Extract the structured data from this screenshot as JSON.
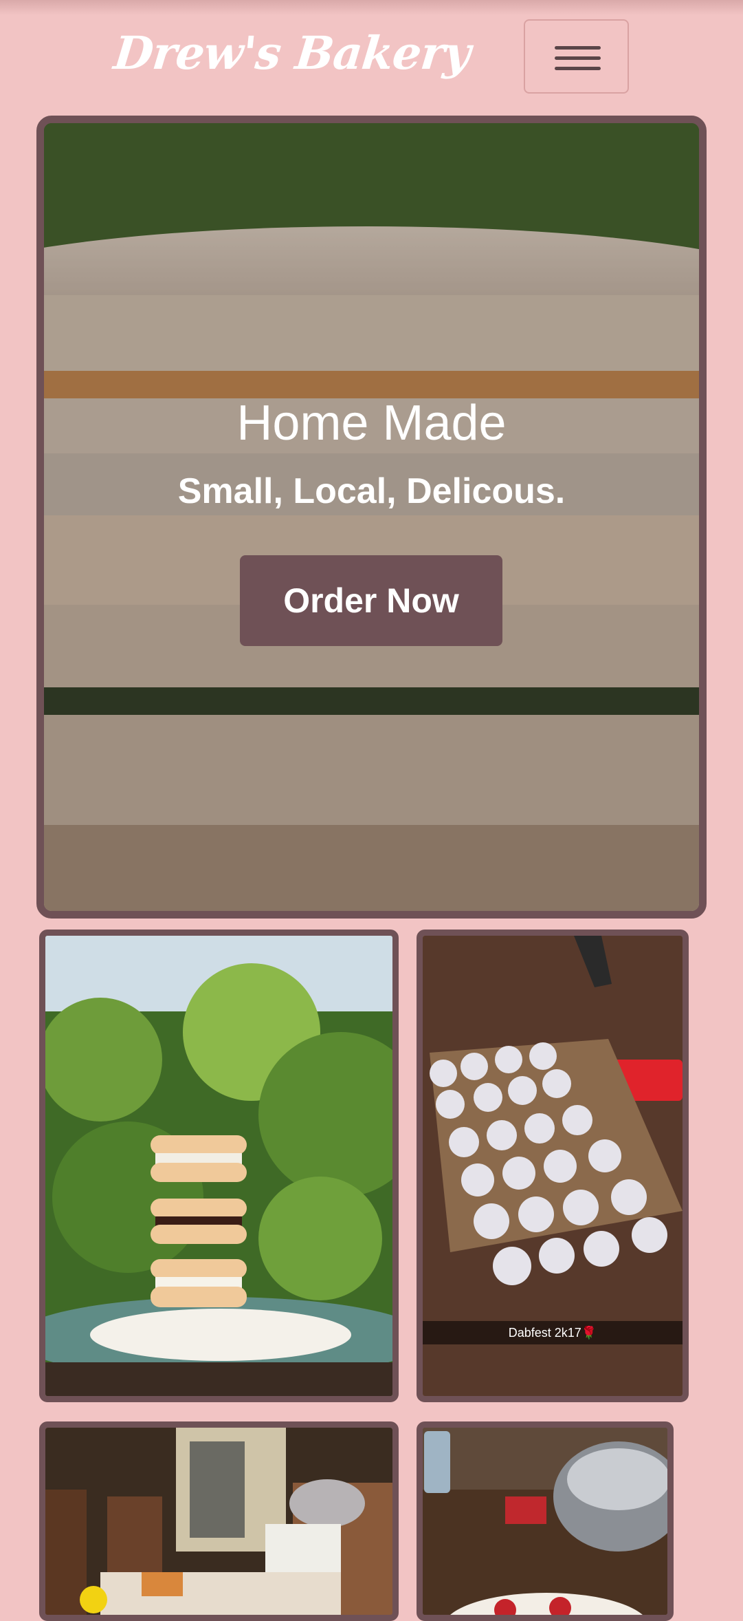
{
  "navbar": {
    "brand": "Drew's Bakery",
    "toggle_icon": "hamburger-menu-icon"
  },
  "hero": {
    "title": "Home Made",
    "subtitle": "Small, Local, Delicous.",
    "button_label": "Order Now"
  },
  "gallery": {
    "cards": [
      {
        "description_icon": "macaron-stack-photo"
      },
      {
        "caption": "Dabfest 2k17🌹"
      },
      {
        "description_icon": "party-table-photo"
      },
      {
        "description_icon": "dessert-photo"
      }
    ]
  },
  "colors": {
    "background": "#f2c4c4",
    "accent": "#6f5156",
    "text": "#ffffff"
  }
}
